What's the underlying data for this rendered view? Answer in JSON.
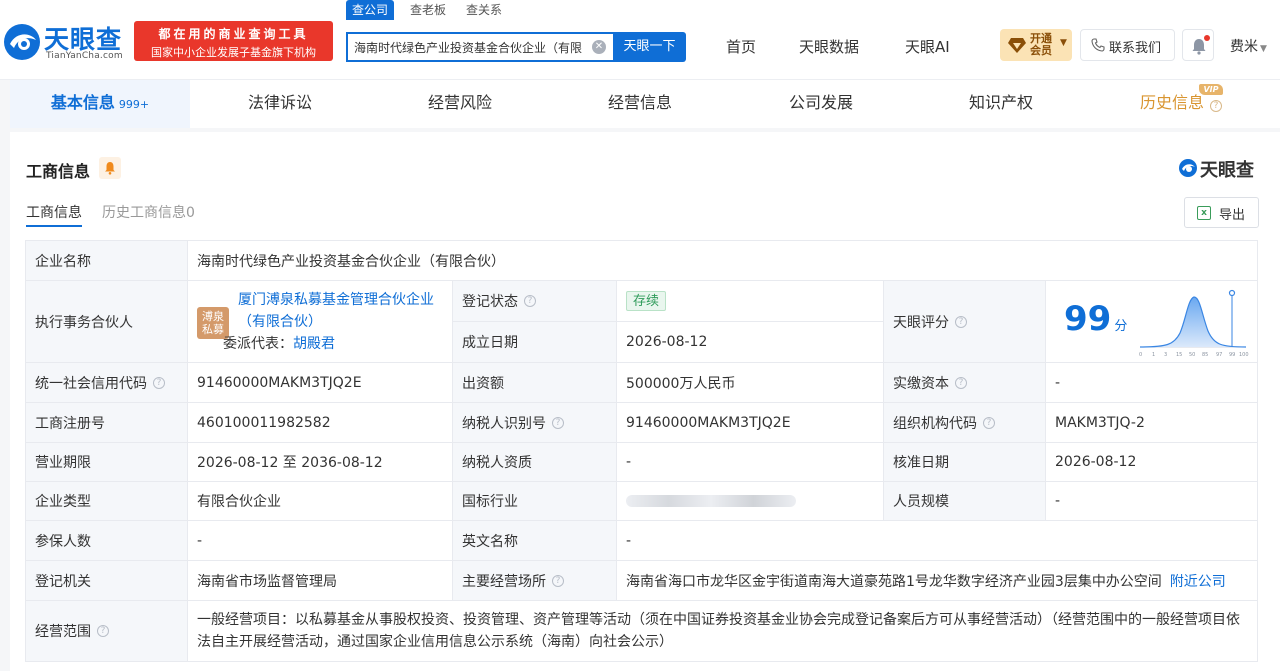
{
  "header": {
    "brand": "天眼查",
    "domain": "TianYanCha.com",
    "slogan_line1": "都在用的商业查询工具",
    "slogan_line2": "国家中小企业发展子基金旗下机构",
    "search_tabs": [
      "查公司",
      "查老板",
      "查关系"
    ],
    "search_value": "海南时代绿色产业投资基金合伙企业（有限",
    "search_button": "天眼一下",
    "nav": [
      "首页",
      "天眼数据",
      "天眼AI"
    ],
    "vip_line1": "开通",
    "vip_line2": "会员",
    "contact": "联系我们",
    "user": "费米"
  },
  "section_tabs": [
    {
      "label": "基本信息",
      "count": "999+"
    },
    {
      "label": "法律诉讼"
    },
    {
      "label": "经营风险"
    },
    {
      "label": "经营信息"
    },
    {
      "label": "公司发展"
    },
    {
      "label": "知识产权"
    },
    {
      "label": "历史信息",
      "tag": "VIP"
    }
  ],
  "card": {
    "title": "工商信息",
    "brand": "天眼查",
    "subtabs": [
      "工商信息",
      "历史工商信息0"
    ],
    "export": "导出"
  },
  "info": {
    "company_name_label": "企业名称",
    "company_name": "海南时代绿色产业投资基金合伙企业（有限合伙）",
    "partner_label": "执行事务合伙人",
    "partner_avatar_l1": "溥泉",
    "partner_avatar_l2": "私募",
    "partner_name_l1": "厦门溥泉私募基金管理合伙企业",
    "partner_name_l2": "（有限合伙）",
    "partner_rep_label": "委派代表：",
    "partner_rep": "胡殿君",
    "reg_status_label": "登记状态",
    "reg_status": "存续",
    "found_date_label": "成立日期",
    "found_date": "2026-08-12",
    "score_label": "天眼评分",
    "score": "99",
    "score_unit": "分",
    "score_axis": [
      "0",
      "1",
      "3",
      "15",
      "50",
      "85",
      "97",
      "99",
      "100"
    ],
    "credit_code_label": "统一社会信用代码",
    "credit_code": "91460000MAKM3TJQ2E",
    "capital_label": "出资额",
    "capital": "500000万人民币",
    "paid_capital_label": "实缴资本",
    "paid_capital": "-",
    "reg_no_label": "工商注册号",
    "reg_no": "460100011982582",
    "tax_id_label": "纳税人识别号",
    "tax_id": "91460000MAKM3TJQ2E",
    "org_code_label": "组织机构代码",
    "org_code": "MAKM3TJQ-2",
    "term_label": "营业期限",
    "term": "2026-08-12 至 2036-08-12",
    "tax_qual_label": "纳税人资质",
    "tax_qual": "-",
    "approve_date_label": "核准日期",
    "approve_date": "2026-08-12",
    "type_label": "企业类型",
    "type": "有限合伙企业",
    "industry_label": "国标行业",
    "staff_label": "人员规模",
    "staff": "-",
    "insured_label": "参保人数",
    "insured": "-",
    "en_name_label": "英文名称",
    "en_name": "-",
    "authority_label": "登记机关",
    "authority": "海南省市场监督管理局",
    "address_label": "主要经营场所",
    "address": "海南省海口市龙华区金宇街道南海大道豪苑路1号龙华数字经济产业园3层集中办公空间",
    "nearby": "附近公司",
    "scope_label": "经营范围",
    "scope": "一般经营项目：以私募基金从事股权投资、投资管理、资产管理等活动（须在中国证券投资基金业协会完成登记备案后方可从事经营活动）（经营范围中的一般经营项目依法自主开展经营活动，通过国家企业信用信息公示系统（海南）向社会公示）"
  },
  "colors": {
    "brand_blue": "#0f6ed6",
    "slogan_red": "#e9372b",
    "history_gold": "#d99530"
  }
}
